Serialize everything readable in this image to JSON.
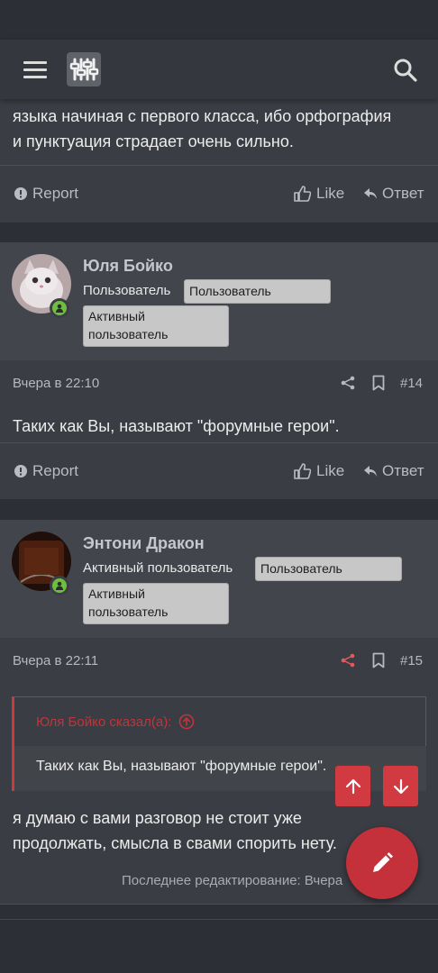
{
  "top_post": {
    "text_line1": "языка начиная с первого класса, ибо орфография",
    "text_line2": "и пунктуация страдает очень сильно.",
    "report": "Report",
    "like": "Like",
    "reply": "Ответ"
  },
  "post14": {
    "username": "Юля Бойко",
    "title": "Пользователь",
    "badge1": "Пользователь",
    "badge2_line1": "Активный",
    "badge2_line2": "пользователь",
    "date": "Вчера в 22:10",
    "number": "#14",
    "text": "Таких как Вы, называют \"форумные герои\".",
    "report": "Report",
    "like": "Like",
    "reply": "Ответ"
  },
  "post15": {
    "username": "Энтони Дракон",
    "title": "Активный пользователь",
    "badge1": "Пользователь",
    "badge2_line1": "Активный",
    "badge2_line2": "пользователь",
    "date": "Вчера в 22:11",
    "number": "#15",
    "quote_author": "Юля Бойко сказал(а):",
    "quote_text": "Таких как Вы, называют \"форумные герои\".",
    "text_line1": "я думаю с вами разговор не стоит уже",
    "text_line2": "продолжать, смысла в свами спорить нету.",
    "edit_note": "Последнее редактирование: Вчера"
  },
  "colors": {
    "accent": "#d13a40",
    "online": "#6fbf3f"
  }
}
